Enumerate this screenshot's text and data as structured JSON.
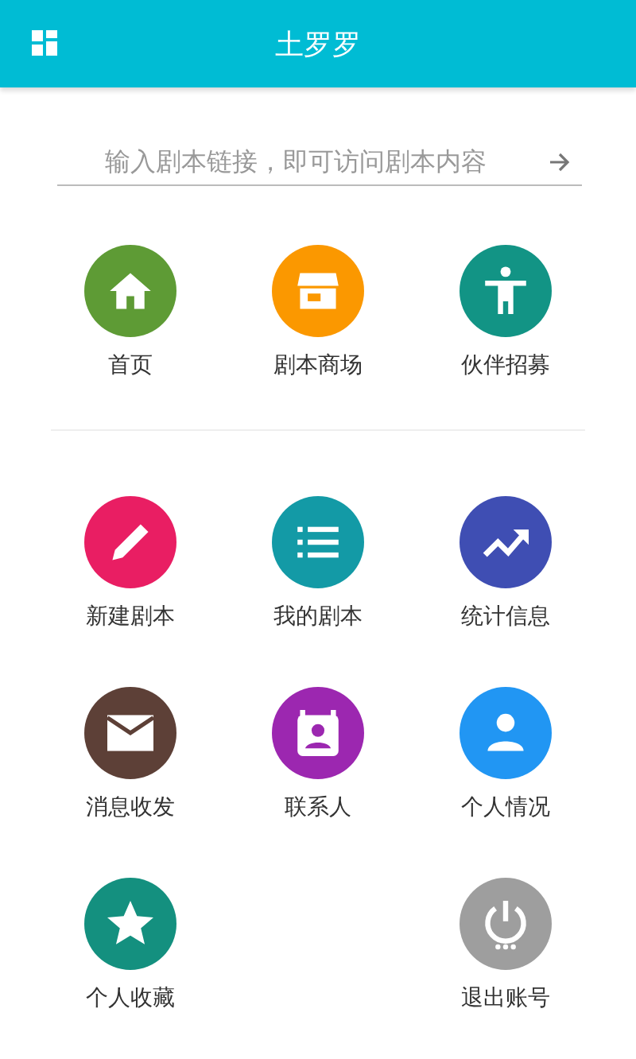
{
  "app_bar": {
    "title": "土罗罗"
  },
  "search": {
    "placeholder": "输入剧本链接，即可访问剧本内容"
  },
  "sections": [
    {
      "items": [
        {
          "kind": "home",
          "label": "首页",
          "color": "#5e9b35"
        },
        {
          "kind": "store",
          "label": "剧本商场",
          "color": "#fb9800"
        },
        {
          "kind": "figure",
          "label": "伙伴招募",
          "color": "#129485"
        }
      ]
    },
    {
      "items": [
        {
          "kind": "pencil",
          "label": "新建剧本",
          "color": "#e91e63"
        },
        {
          "kind": "list",
          "label": "我的剧本",
          "color": "#139aa6"
        },
        {
          "kind": "trend",
          "label": "统计信息",
          "color": "#3f4eb3"
        },
        {
          "kind": "mail",
          "label": "消息收发",
          "color": "#5d4037"
        },
        {
          "kind": "contact",
          "label": "联系人",
          "color": "#9c27b0"
        },
        {
          "kind": "person",
          "label": "个人情况",
          "color": "#2196f3"
        },
        {
          "kind": "star",
          "label": "个人收藏",
          "color": "#14907f"
        },
        {
          "kind": "blank"
        },
        {
          "kind": "power",
          "label": "退出账号",
          "color": "#9e9e9e"
        }
      ]
    }
  ]
}
